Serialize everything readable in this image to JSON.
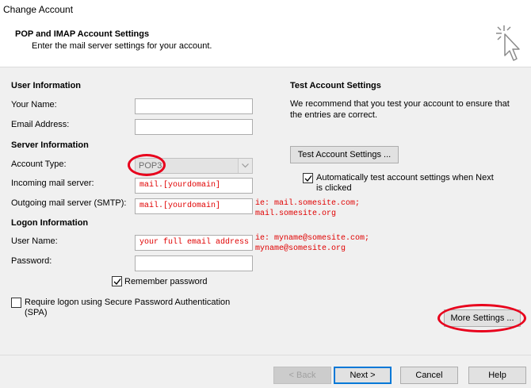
{
  "window": {
    "title": "Change Account"
  },
  "header": {
    "heading": "POP and IMAP Account Settings",
    "subheading": "Enter the mail server settings for your account."
  },
  "user_info": {
    "section": "User Information",
    "name_label": "Your Name:",
    "name_value": "",
    "email_label": "Email Address:",
    "email_value": ""
  },
  "server_info": {
    "section": "Server Information",
    "account_type_label": "Account Type:",
    "account_type_value": "POP3",
    "incoming_label": "Incoming mail server:",
    "incoming_value": "mail.[yourdomain]",
    "outgoing_label": "Outgoing mail server (SMTP):",
    "outgoing_value": "mail.[yourdomain]",
    "outgoing_hint_1": "ie: mail.somesite.com;",
    "outgoing_hint_2": "mail.somesite.org"
  },
  "logon_info": {
    "section": "Logon Information",
    "username_label": "User Name:",
    "username_value": "your full email address",
    "username_hint_1": "ie: myname@somesite.com;",
    "username_hint_2": "myname@somesite.org",
    "password_label": "Password:",
    "password_value": "",
    "remember_label": "Remember password",
    "remember_checked": true,
    "spa_label_1": "Require logon using Secure Password Authentication",
    "spa_label_2": "(SPA)",
    "spa_checked": false
  },
  "test_settings": {
    "section": "Test Account Settings",
    "desc_1": "We recommend that you test your account to ensure that",
    "desc_2": "the entries are correct.",
    "test_button": "Test Account Settings ...",
    "auto_test_label_1": "Automatically test account settings when Next",
    "auto_test_label_2": "is clicked",
    "auto_test_checked": true,
    "more_settings_button": "More Settings ..."
  },
  "footer": {
    "back": "< Back",
    "next": "Next >",
    "cancel": "Cancel",
    "help": "Help"
  },
  "colors": {
    "annotation_red": "#e8001c",
    "hint_red": "#e00000",
    "accent_blue": "#0078d7"
  },
  "icons": {
    "header": "cursor-click-icon",
    "dropdown": "chevron-down-icon",
    "checkbox": "checkmark-icon"
  }
}
